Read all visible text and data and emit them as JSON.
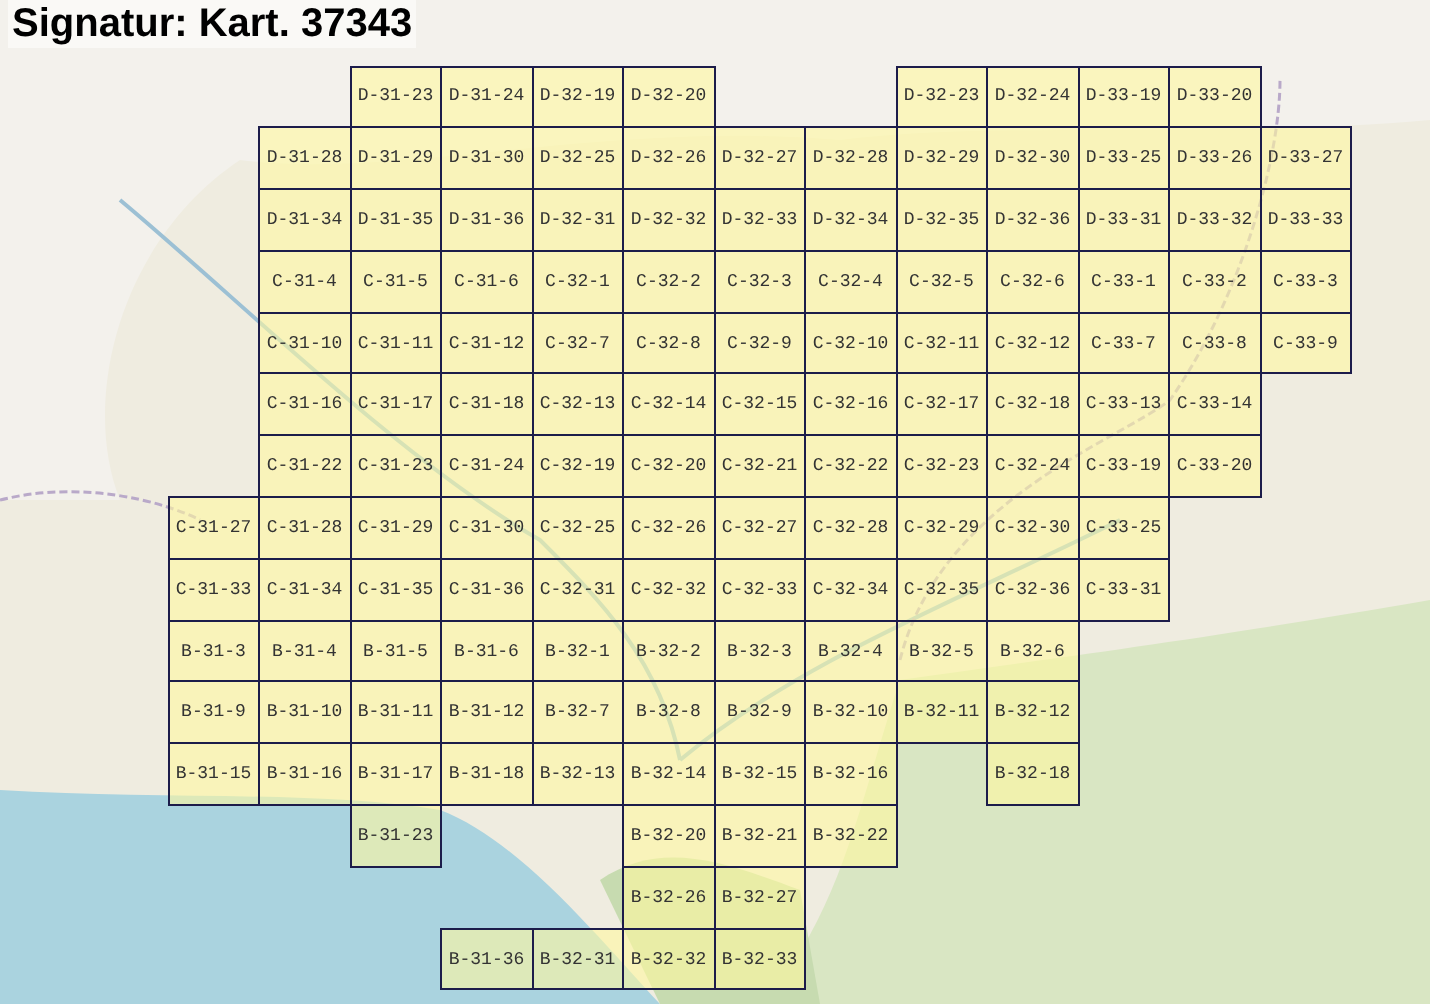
{
  "title": "Signatur: Kart. 37343",
  "grid_rows": [
    {
      "cells": [
        {
          "kind": "gap"
        },
        {
          "kind": "gap"
        },
        {
          "kind": "sheet",
          "label": "D-31-23"
        },
        {
          "kind": "sheet",
          "label": "D-31-24"
        },
        {
          "kind": "sheet",
          "label": "D-32-19"
        },
        {
          "kind": "sheet",
          "label": "D-32-20"
        },
        {
          "kind": "gap"
        },
        {
          "kind": "gap"
        },
        {
          "kind": "sheet",
          "label": "D-32-23"
        },
        {
          "kind": "sheet",
          "label": "D-32-24"
        },
        {
          "kind": "sheet",
          "label": "D-33-19"
        },
        {
          "kind": "sheet",
          "label": "D-33-20"
        }
      ]
    },
    {
      "cells": [
        {
          "kind": "gap"
        },
        {
          "kind": "sheet",
          "label": "D-31-28"
        },
        {
          "kind": "sheet",
          "label": "D-31-29"
        },
        {
          "kind": "sheet",
          "label": "D-31-30"
        },
        {
          "kind": "sheet",
          "label": "D-32-25"
        },
        {
          "kind": "sheet",
          "label": "D-32-26"
        },
        {
          "kind": "sheet",
          "label": "D-32-27"
        },
        {
          "kind": "sheet",
          "label": "D-32-28"
        },
        {
          "kind": "sheet",
          "label": "D-32-29"
        },
        {
          "kind": "sheet",
          "label": "D-32-30"
        },
        {
          "kind": "sheet",
          "label": "D-33-25"
        },
        {
          "kind": "sheet",
          "label": "D-33-26"
        },
        {
          "kind": "sheet",
          "label": "D-33-27"
        }
      ]
    },
    {
      "cells": [
        {
          "kind": "gap"
        },
        {
          "kind": "sheet",
          "label": "D-31-34"
        },
        {
          "kind": "sheet",
          "label": "D-31-35"
        },
        {
          "kind": "sheet",
          "label": "D-31-36"
        },
        {
          "kind": "sheet",
          "label": "D-32-31"
        },
        {
          "kind": "sheet",
          "label": "D-32-32"
        },
        {
          "kind": "sheet",
          "label": "D-32-33"
        },
        {
          "kind": "sheet",
          "label": "D-32-34"
        },
        {
          "kind": "sheet",
          "label": "D-32-35"
        },
        {
          "kind": "sheet",
          "label": "D-32-36"
        },
        {
          "kind": "sheet",
          "label": "D-33-31"
        },
        {
          "kind": "sheet",
          "label": "D-33-32"
        },
        {
          "kind": "sheet",
          "label": "D-33-33"
        }
      ]
    },
    {
      "cells": [
        {
          "kind": "gap"
        },
        {
          "kind": "sheet",
          "label": "C-31-4"
        },
        {
          "kind": "sheet",
          "label": "C-31-5"
        },
        {
          "kind": "sheet",
          "label": "C-31-6"
        },
        {
          "kind": "sheet",
          "label": "C-32-1"
        },
        {
          "kind": "sheet",
          "label": "C-32-2"
        },
        {
          "kind": "sheet",
          "label": "C-32-3"
        },
        {
          "kind": "sheet",
          "label": "C-32-4"
        },
        {
          "kind": "sheet",
          "label": "C-32-5"
        },
        {
          "kind": "sheet",
          "label": "C-32-6"
        },
        {
          "kind": "sheet",
          "label": "C-33-1"
        },
        {
          "kind": "sheet",
          "label": "C-33-2"
        },
        {
          "kind": "sheet",
          "label": "C-33-3"
        }
      ]
    },
    {
      "cells": [
        {
          "kind": "gap"
        },
        {
          "kind": "sheet",
          "label": "C-31-10"
        },
        {
          "kind": "sheet",
          "label": "C-31-11"
        },
        {
          "kind": "sheet",
          "label": "C-31-12"
        },
        {
          "kind": "sheet",
          "label": "C-32-7"
        },
        {
          "kind": "sheet",
          "label": "C-32-8"
        },
        {
          "kind": "sheet",
          "label": "C-32-9"
        },
        {
          "kind": "sheet",
          "label": "C-32-10"
        },
        {
          "kind": "sheet",
          "label": "C-32-11"
        },
        {
          "kind": "sheet",
          "label": "C-32-12"
        },
        {
          "kind": "sheet",
          "label": "C-33-7"
        },
        {
          "kind": "sheet",
          "label": "C-33-8"
        },
        {
          "kind": "sheet",
          "label": "C-33-9"
        }
      ]
    },
    {
      "cells": [
        {
          "kind": "gap"
        },
        {
          "kind": "sheet",
          "label": "C-31-16"
        },
        {
          "kind": "sheet",
          "label": "C-31-17"
        },
        {
          "kind": "sheet",
          "label": "C-31-18"
        },
        {
          "kind": "sheet",
          "label": "C-32-13"
        },
        {
          "kind": "sheet",
          "label": "C-32-14"
        },
        {
          "kind": "sheet",
          "label": "C-32-15"
        },
        {
          "kind": "sheet",
          "label": "C-32-16"
        },
        {
          "kind": "sheet",
          "label": "C-32-17"
        },
        {
          "kind": "sheet",
          "label": "C-32-18"
        },
        {
          "kind": "sheet",
          "label": "C-33-13"
        },
        {
          "kind": "sheet",
          "label": "C-33-14"
        }
      ]
    },
    {
      "cells": [
        {
          "kind": "gap"
        },
        {
          "kind": "sheet",
          "label": "C-31-22"
        },
        {
          "kind": "sheet",
          "label": "C-31-23"
        },
        {
          "kind": "sheet",
          "label": "C-31-24"
        },
        {
          "kind": "sheet",
          "label": "C-32-19"
        },
        {
          "kind": "sheet",
          "label": "C-32-20"
        },
        {
          "kind": "sheet",
          "label": "C-32-21"
        },
        {
          "kind": "sheet",
          "label": "C-32-22"
        },
        {
          "kind": "sheet",
          "label": "C-32-23"
        },
        {
          "kind": "sheet",
          "label": "C-32-24"
        },
        {
          "kind": "sheet",
          "label": "C-33-19"
        },
        {
          "kind": "sheet",
          "label": "C-33-20"
        }
      ]
    },
    {
      "cells": [
        {
          "kind": "sheet",
          "label": "C-31-27"
        },
        {
          "kind": "sheet",
          "label": "C-31-28"
        },
        {
          "kind": "sheet",
          "label": "C-31-29"
        },
        {
          "kind": "sheet",
          "label": "C-31-30"
        },
        {
          "kind": "sheet",
          "label": "C-32-25"
        },
        {
          "kind": "sheet",
          "label": "C-32-26"
        },
        {
          "kind": "sheet",
          "label": "C-32-27"
        },
        {
          "kind": "sheet",
          "label": "C-32-28"
        },
        {
          "kind": "sheet",
          "label": "C-32-29"
        },
        {
          "kind": "sheet",
          "label": "C-32-30"
        },
        {
          "kind": "sheet",
          "label": "C-33-25"
        }
      ]
    },
    {
      "cells": [
        {
          "kind": "sheet",
          "label": "C-31-33"
        },
        {
          "kind": "sheet",
          "label": "C-31-34"
        },
        {
          "kind": "sheet",
          "label": "C-31-35"
        },
        {
          "kind": "sheet",
          "label": "C-31-36"
        },
        {
          "kind": "sheet",
          "label": "C-32-31"
        },
        {
          "kind": "sheet",
          "label": "C-32-32"
        },
        {
          "kind": "sheet",
          "label": "C-32-33"
        },
        {
          "kind": "sheet",
          "label": "C-32-34"
        },
        {
          "kind": "sheet",
          "label": "C-32-35"
        },
        {
          "kind": "sheet",
          "label": "C-32-36"
        },
        {
          "kind": "sheet",
          "label": "C-33-31"
        }
      ]
    },
    {
      "cells": [
        {
          "kind": "sheet",
          "label": "B-31-3"
        },
        {
          "kind": "sheet",
          "label": "B-31-4"
        },
        {
          "kind": "sheet",
          "label": "B-31-5"
        },
        {
          "kind": "sheet",
          "label": "B-31-6"
        },
        {
          "kind": "sheet",
          "label": "B-32-1"
        },
        {
          "kind": "sheet",
          "label": "B-32-2"
        },
        {
          "kind": "sheet",
          "label": "B-32-3"
        },
        {
          "kind": "sheet",
          "label": "B-32-4"
        },
        {
          "kind": "sheet",
          "label": "B-32-5"
        },
        {
          "kind": "sheet",
          "label": "B-32-6"
        }
      ]
    },
    {
      "cells": [
        {
          "kind": "sheet",
          "label": "B-31-9"
        },
        {
          "kind": "sheet",
          "label": "B-31-10"
        },
        {
          "kind": "sheet",
          "label": "B-31-11"
        },
        {
          "kind": "sheet",
          "label": "B-31-12"
        },
        {
          "kind": "sheet",
          "label": "B-32-7"
        },
        {
          "kind": "sheet",
          "label": "B-32-8"
        },
        {
          "kind": "sheet",
          "label": "B-32-9"
        },
        {
          "kind": "sheet",
          "label": "B-32-10"
        },
        {
          "kind": "sheet",
          "label": "B-32-11"
        },
        {
          "kind": "sheet",
          "label": "B-32-12"
        }
      ]
    },
    {
      "cells": [
        {
          "kind": "sheet",
          "label": "B-31-15"
        },
        {
          "kind": "sheet",
          "label": "B-31-16"
        },
        {
          "kind": "sheet",
          "label": "B-31-17"
        },
        {
          "kind": "sheet",
          "label": "B-31-18"
        },
        {
          "kind": "sheet",
          "label": "B-32-13"
        },
        {
          "kind": "sheet",
          "label": "B-32-14"
        },
        {
          "kind": "sheet",
          "label": "B-32-15"
        },
        {
          "kind": "sheet",
          "label": "B-32-16"
        },
        {
          "kind": "gap"
        },
        {
          "kind": "sheet",
          "label": "B-32-18"
        }
      ]
    },
    {
      "cells": [
        {
          "kind": "gap"
        },
        {
          "kind": "gap"
        },
        {
          "kind": "sheet",
          "label": "B-31-23"
        },
        {
          "kind": "gap"
        },
        {
          "kind": "gap"
        },
        {
          "kind": "sheet",
          "label": "B-32-20"
        },
        {
          "kind": "sheet",
          "label": "B-32-21"
        },
        {
          "kind": "sheet",
          "label": "B-32-22"
        }
      ]
    },
    {
      "cells": [
        {
          "kind": "gap"
        },
        {
          "kind": "gap"
        },
        {
          "kind": "gap"
        },
        {
          "kind": "gap"
        },
        {
          "kind": "gap"
        },
        {
          "kind": "sheet",
          "label": "B-32-26"
        },
        {
          "kind": "sheet",
          "label": "B-32-27"
        }
      ]
    },
    {
      "cells": [
        {
          "kind": "gap"
        },
        {
          "kind": "gap"
        },
        {
          "kind": "gap"
        },
        {
          "kind": "sheet",
          "label": "B-31-36"
        },
        {
          "kind": "sheet",
          "label": "B-32-31"
        },
        {
          "kind": "sheet",
          "label": "B-32-32"
        },
        {
          "kind": "sheet",
          "label": "B-32-33"
        }
      ]
    }
  ]
}
